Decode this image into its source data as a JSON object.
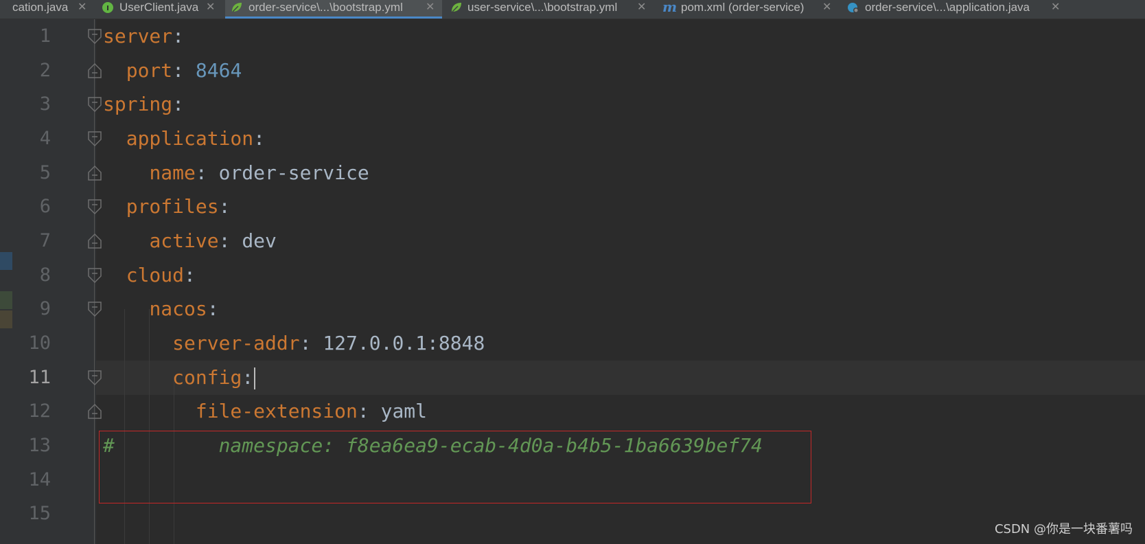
{
  "tabs": [
    {
      "label": "cation.java",
      "icon": "none",
      "active": false
    },
    {
      "label": "UserClient.java",
      "icon": "interface-icon",
      "active": false
    },
    {
      "label": "order-service\\...\\bootstrap.yml",
      "icon": "spring-leaf-icon",
      "active": true
    },
    {
      "label": "user-service\\...\\bootstrap.yml",
      "icon": "spring-leaf-icon",
      "active": false
    },
    {
      "label": "pom.xml (order-service)",
      "icon": "maven-icon",
      "active": false
    },
    {
      "label": "order-service\\...\\application.java",
      "icon": "class-icon",
      "active": false
    }
  ],
  "editor": {
    "current_line": 11,
    "lines": [
      {
        "num": "1",
        "indent": "",
        "key": "server",
        "colon": ":",
        "value": "",
        "value_type": ""
      },
      {
        "num": "2",
        "indent": "  ",
        "key": "port",
        "colon": ": ",
        "value": "8464",
        "value_type": "number"
      },
      {
        "num": "3",
        "indent": "",
        "key": "spring",
        "colon": ":",
        "value": "",
        "value_type": ""
      },
      {
        "num": "4",
        "indent": "  ",
        "key": "application",
        "colon": ":",
        "value": "",
        "value_type": ""
      },
      {
        "num": "5",
        "indent": "    ",
        "key": "name",
        "colon": ": ",
        "value": "order-service",
        "value_type": "string"
      },
      {
        "num": "6",
        "indent": "  ",
        "key": "profiles",
        "colon": ":",
        "value": "",
        "value_type": ""
      },
      {
        "num": "7",
        "indent": "    ",
        "key": "active",
        "colon": ": ",
        "value": "dev",
        "value_type": "string"
      },
      {
        "num": "8",
        "indent": "  ",
        "key": "cloud",
        "colon": ":",
        "value": "",
        "value_type": ""
      },
      {
        "num": "9",
        "indent": "    ",
        "key": "nacos",
        "colon": ":",
        "value": "",
        "value_type": ""
      },
      {
        "num": "10",
        "indent": "      ",
        "key": "server-addr",
        "colon": ": ",
        "value": "127.0.0.1:8848",
        "value_type": "string"
      },
      {
        "num": "11",
        "indent": "      ",
        "key": "config",
        "colon": ":",
        "value": "",
        "value_type": ""
      },
      {
        "num": "12",
        "indent": "        ",
        "key": "file-extension",
        "colon": ": ",
        "value": "yaml",
        "value_type": "string"
      },
      {
        "num": "13",
        "comment": "#         namespace: f8ea6ea9-ecab-4d0a-b4b5-1ba6639bef74"
      },
      {
        "num": "14"
      },
      {
        "num": "15"
      }
    ]
  },
  "watermark": "CSDN @你是一块番薯吗",
  "colors": {
    "keyword": "#cc7832",
    "number": "#6897bb",
    "comment": "#629755",
    "text": "#a9b7c6",
    "highlight_box": "#c62828",
    "active_tab_underline": "#4a88c7"
  }
}
